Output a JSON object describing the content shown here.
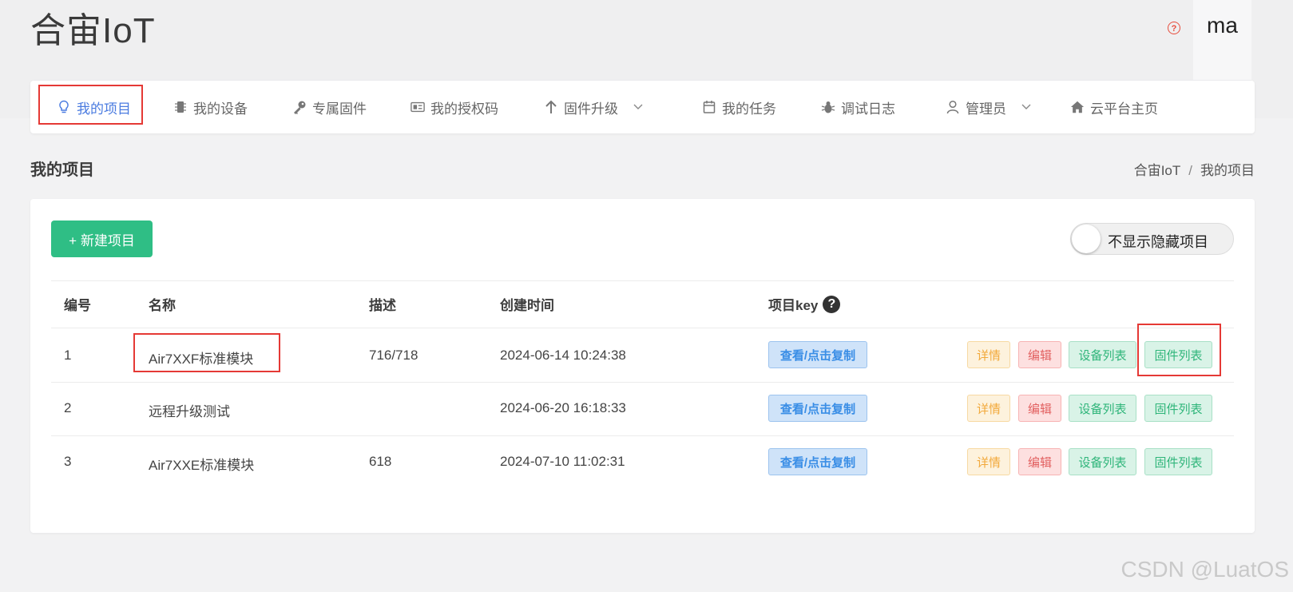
{
  "app": {
    "brand": "合宙IoT",
    "user": "ma",
    "help_glyph": "?"
  },
  "colors": {
    "accent": "#4a7be0",
    "primary_button": "#2fbe85",
    "highlight_box": "#e53935"
  },
  "nav": {
    "items": [
      {
        "label": "我的项目",
        "icon": "lightbulb-icon"
      },
      {
        "label": "我的设备",
        "icon": "chip-icon"
      },
      {
        "label": "专属固件",
        "icon": "key-icon"
      },
      {
        "label": "我的授权码",
        "icon": "id-card-icon"
      },
      {
        "label": "固件升级",
        "icon": "arrow-up-icon",
        "dropdown": true
      },
      {
        "label": "我的任务",
        "icon": "calendar-icon"
      },
      {
        "label": "调试日志",
        "icon": "bug-icon"
      },
      {
        "label": "管理员",
        "icon": "user-icon",
        "dropdown": true
      },
      {
        "label": "云平台主页",
        "icon": "home-icon"
      }
    ],
    "active": "我的项目"
  },
  "page": {
    "title": "我的项目",
    "breadcrumb": [
      "合宙IoT",
      "我的项目"
    ],
    "breadcrumb_sep": "/"
  },
  "toolbar": {
    "new_button": "+ 新建项目",
    "toggle_label": "不显示隐藏项目",
    "toggle_on": false
  },
  "table": {
    "headers": [
      "编号",
      "名称",
      "描述",
      "创建时间",
      "项目key"
    ],
    "rows": [
      {
        "id": "1",
        "name": "Air7XXF标准模块",
        "desc": "716/718",
        "created": "2024-06-14 10:24:38",
        "key_btn": "查看/点击复制"
      },
      {
        "id": "2",
        "name": "远程升级测试",
        "desc": "",
        "created": "2024-06-20 16:18:33",
        "key_btn": "查看/点击复制"
      },
      {
        "id": "3",
        "name": "Air7XXE标准模块",
        "desc": "618",
        "created": "2024-07-10 11:02:31",
        "key_btn": "查看/点击复制"
      }
    ],
    "actions": {
      "detail": "详情",
      "edit": "编辑",
      "devices": "设备列表",
      "firmware": "固件列表"
    }
  },
  "watermark": "CSDN @LuatOS"
}
